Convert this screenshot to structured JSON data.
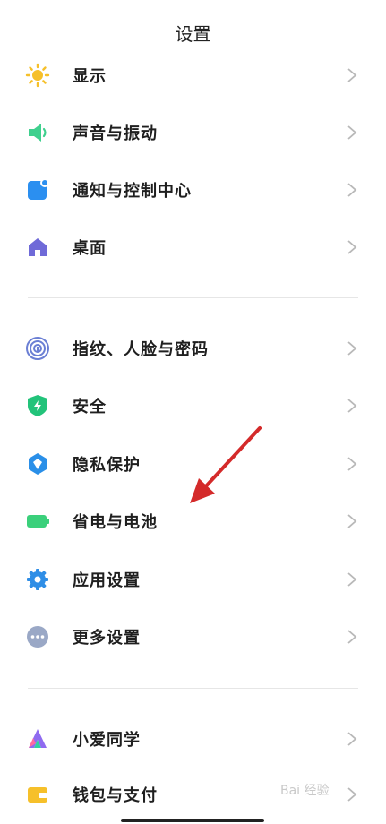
{
  "header": {
    "title": "设置"
  },
  "group1": [
    {
      "label": "显示",
      "icon": "sun-icon"
    },
    {
      "label": "声音与振动",
      "icon": "speaker-icon"
    },
    {
      "label": "通知与控制中心",
      "icon": "notification-icon"
    },
    {
      "label": "桌面",
      "icon": "home-icon"
    }
  ],
  "group2": [
    {
      "label": "指纹、人脸与密码",
      "icon": "fingerprint-icon"
    },
    {
      "label": "安全",
      "icon": "shield-icon"
    },
    {
      "label": "隐私保护",
      "icon": "privacy-icon"
    },
    {
      "label": "省电与电池",
      "icon": "battery-icon"
    },
    {
      "label": "应用设置",
      "icon": "gear-icon"
    },
    {
      "label": "更多设置",
      "icon": "more-icon"
    }
  ],
  "group3": [
    {
      "label": "小爱同学",
      "icon": "xiaoai-icon"
    },
    {
      "label": "钱包与支付",
      "icon": "wallet-icon"
    }
  ],
  "watermark": {
    "text": "Bai 经验"
  },
  "colors": {
    "sun": "#f6c02a",
    "speaker": "#3fd08e",
    "notification": "#2b8ff0",
    "home": "#6f6ad8",
    "fingerprint": "#6b7fd4",
    "shield": "#22c37a",
    "privacy": "#2a8fe8",
    "battery": "#3bd07b",
    "gear": "#2f8ee6",
    "more": "#7f8fb0",
    "arrow": "#d42a2a"
  }
}
